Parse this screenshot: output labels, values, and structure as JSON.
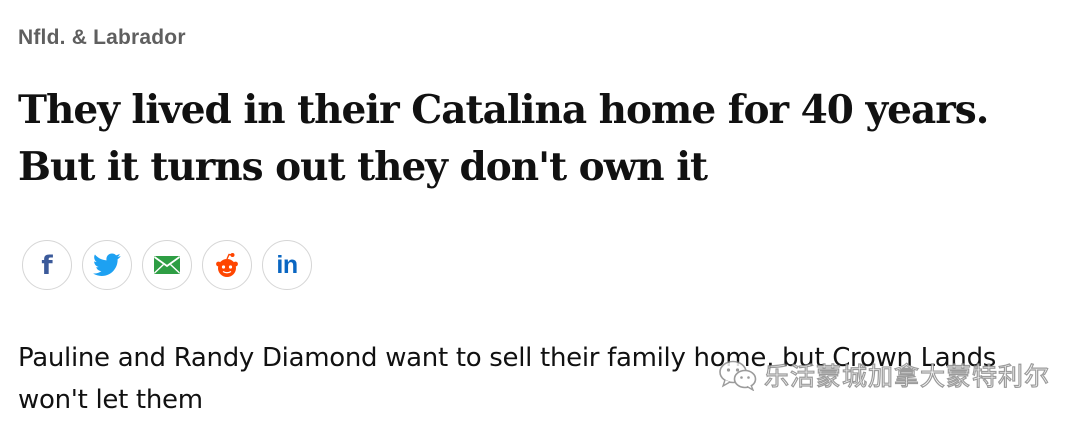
{
  "article": {
    "section": "Nfld. & Labrador",
    "headline": "They lived in their Catalina home for 40 years. But it turns out they don't own it",
    "deck": "Pauline and Randy Diamond want to sell their family home, but Crown Lands won't let them"
  },
  "share_buttons": [
    {
      "name": "facebook",
      "icon": "facebook-icon",
      "color": "#3b5a9a"
    },
    {
      "name": "twitter",
      "icon": "twitter-icon",
      "color": "#1da1f2"
    },
    {
      "name": "email",
      "icon": "email-icon",
      "color": "#2e9e44"
    },
    {
      "name": "reddit",
      "icon": "reddit-icon",
      "color": "#ff4500"
    },
    {
      "name": "linkedin",
      "icon": "linkedin-icon",
      "color": "#0a66c2"
    }
  ],
  "watermark": {
    "icon": "wechat-icon",
    "text": "乐活蒙城加拿大蒙特利尔"
  }
}
